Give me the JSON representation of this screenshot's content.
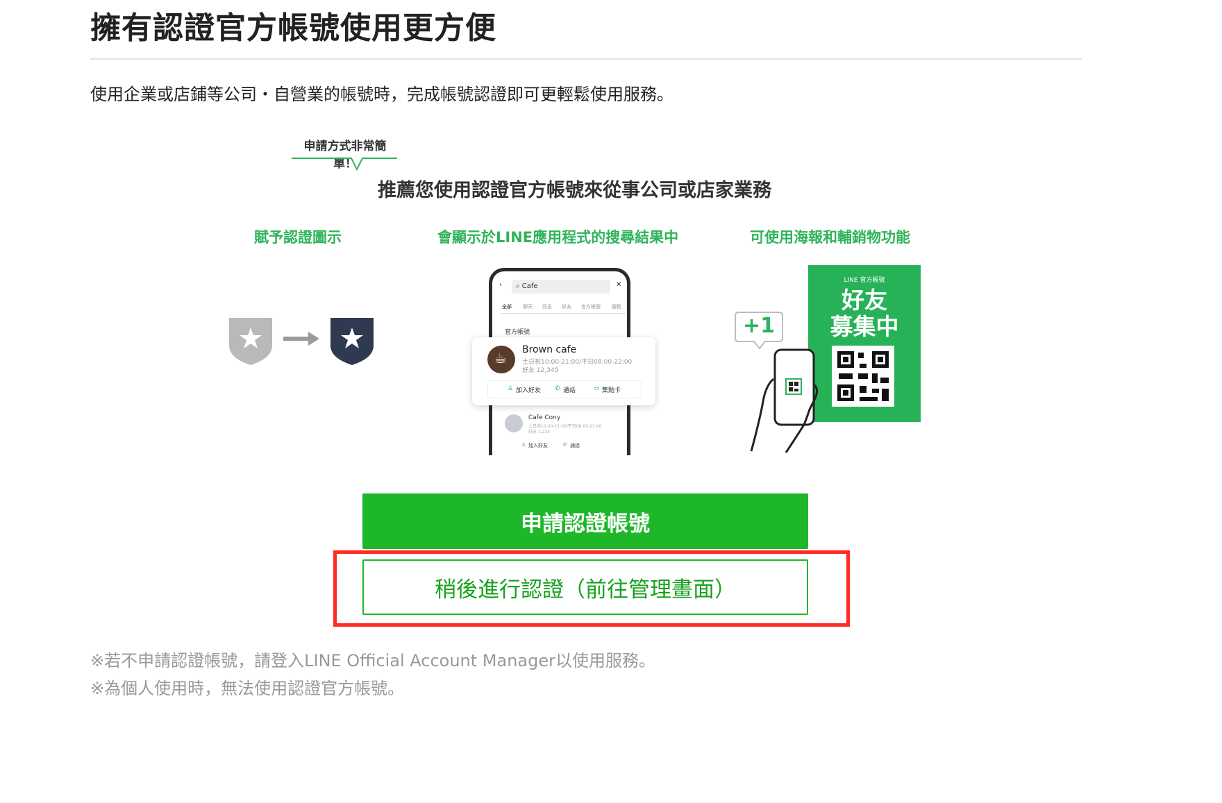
{
  "header": {
    "title": "擁有認證官方帳號使用更方便",
    "description": "使用企業或店鋪等公司・自營業的帳號時，完成帳號認證即可更輕鬆使用服務。"
  },
  "promo": {
    "bubble_text": "申請方式非常簡單！",
    "subtitle": "推薦您使用認證官方帳號來從事公司或店家業務",
    "features": [
      {
        "label": "賦予認證圖示"
      },
      {
        "label": "會顯示於LINE應用程式的搜尋結果中"
      },
      {
        "label": "可使用海報和輔銷物功能"
      }
    ],
    "phone": {
      "search_text": "Cafe",
      "tabs": [
        "全部",
        "聊天",
        "訊息",
        "好友",
        "官方帳號",
        "服務"
      ],
      "section_label": "官方帳號",
      "card": {
        "name": "Brown cafe",
        "hours": "土日祝10:00-21:00/平日08:00-22:00",
        "friends": "好友 12,345",
        "actions": [
          "加入好友",
          "通話",
          "集點卡"
        ]
      },
      "second": {
        "name": "Cafe Cony",
        "hours": "土日祝10:00-21:00/平日08:00-21:00",
        "friends": "好友 1,234",
        "actions": [
          "加入好友",
          "通話"
        ]
      }
    },
    "plus_label": "+1",
    "poster": {
      "top_label": "LINE 官方帳號",
      "line1": "好友",
      "line2": "募集中"
    }
  },
  "actions": {
    "primary_label": "申請認證帳號",
    "secondary_label": "稍後進行認證（前往管理畫面）"
  },
  "notes": [
    "※若不申請認證帳號，請登入LINE Official Account Manager以使用服務。",
    "※為個人使用時，無法使用認證官方帳號。"
  ],
  "colors": {
    "brand_green": "#1fb72a",
    "feature_green": "#2fb35a",
    "badge_navy": "#2f3a52",
    "highlight_red": "#ff2b25"
  }
}
